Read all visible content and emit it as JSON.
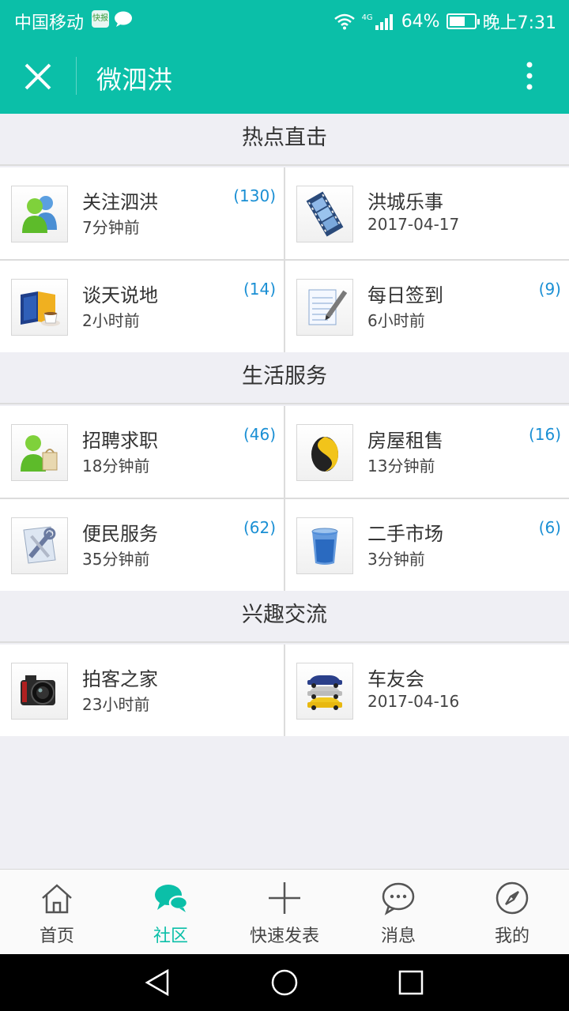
{
  "status_bar": {
    "carrier": "中国移动",
    "app_badge": "快报",
    "network": "4G",
    "battery": "64%",
    "battery_level": 0.64,
    "time": "晚上7:31"
  },
  "header": {
    "title": "微泗洪",
    "close_icon": "close-icon",
    "more_icon": "more-vertical-icon"
  },
  "sections": [
    {
      "title": "热点直击",
      "items": [
        {
          "name": "关注泗洪",
          "time": "7分钟前",
          "count": "(130)",
          "icon": "users-icon"
        },
        {
          "name": "洪城乐事",
          "time": "2017-04-17",
          "count": "",
          "icon": "film-icon"
        },
        {
          "name": "谈天说地",
          "time": "2小时前",
          "count": "(14)",
          "icon": "book-coffee-icon"
        },
        {
          "name": "每日签到",
          "time": "6小时前",
          "count": "(9)",
          "icon": "notepad-icon"
        }
      ]
    },
    {
      "title": "生活服务",
      "items": [
        {
          "name": "招聘求职",
          "time": "18分钟前",
          "count": "(46)",
          "icon": "user-bag-icon"
        },
        {
          "name": "房屋租售",
          "time": "13分钟前",
          "count": "(16)",
          "icon": "yin-yang-icon"
        },
        {
          "name": "便民服务",
          "time": "35分钟前",
          "count": "(62)",
          "icon": "tools-icon"
        },
        {
          "name": "二手市场",
          "time": "3分钟前",
          "count": "(6)",
          "icon": "bin-icon"
        }
      ]
    },
    {
      "title": "兴趣交流",
      "items": [
        {
          "name": "拍客之家",
          "time": "23小时前",
          "count": "",
          "icon": "camera-icon"
        },
        {
          "name": "车友会",
          "time": "2017-04-16",
          "count": "",
          "icon": "cars-icon"
        }
      ]
    }
  ],
  "tabbar": {
    "items": [
      {
        "label": "首页",
        "icon": "home-icon"
      },
      {
        "label": "社区",
        "icon": "chat-bubbles-icon"
      },
      {
        "label": "快速发表",
        "icon": "plus-icon"
      },
      {
        "label": "消息",
        "icon": "message-icon"
      },
      {
        "label": "我的",
        "icon": "compass-icon"
      }
    ],
    "active_index": 1
  },
  "colors": {
    "accent": "#0bbfa8",
    "count": "#1a8fd4",
    "background": "#efeff4"
  }
}
